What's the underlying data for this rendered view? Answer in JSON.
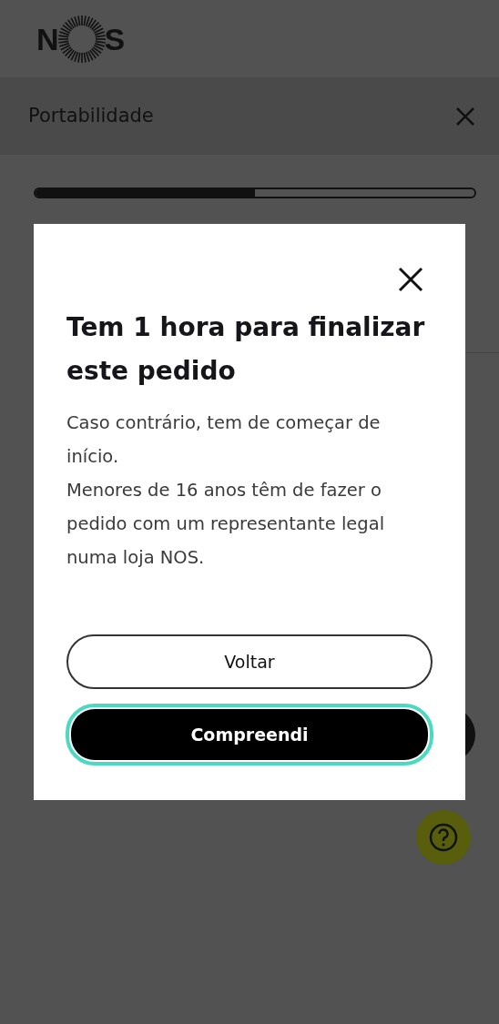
{
  "logo": {
    "letters": [
      "N",
      "S"
    ]
  },
  "header": {
    "title": "Portabilidade"
  },
  "progress": {
    "level": 0.5
  },
  "dialog": {
    "title": "Tem 1 hora para finalizar este pedido",
    "paragraphs": [
      "Caso contrário, tem de começar de início.",
      "Menores de 16 anos têm de fazer o pedido com um representante legal numa loja NOS."
    ],
    "buttons": [
      {
        "label": "Voltar",
        "kind": "outline",
        "focused": false
      },
      {
        "label": "Compreendi",
        "kind": "solid",
        "focused": true
      }
    ]
  }
}
